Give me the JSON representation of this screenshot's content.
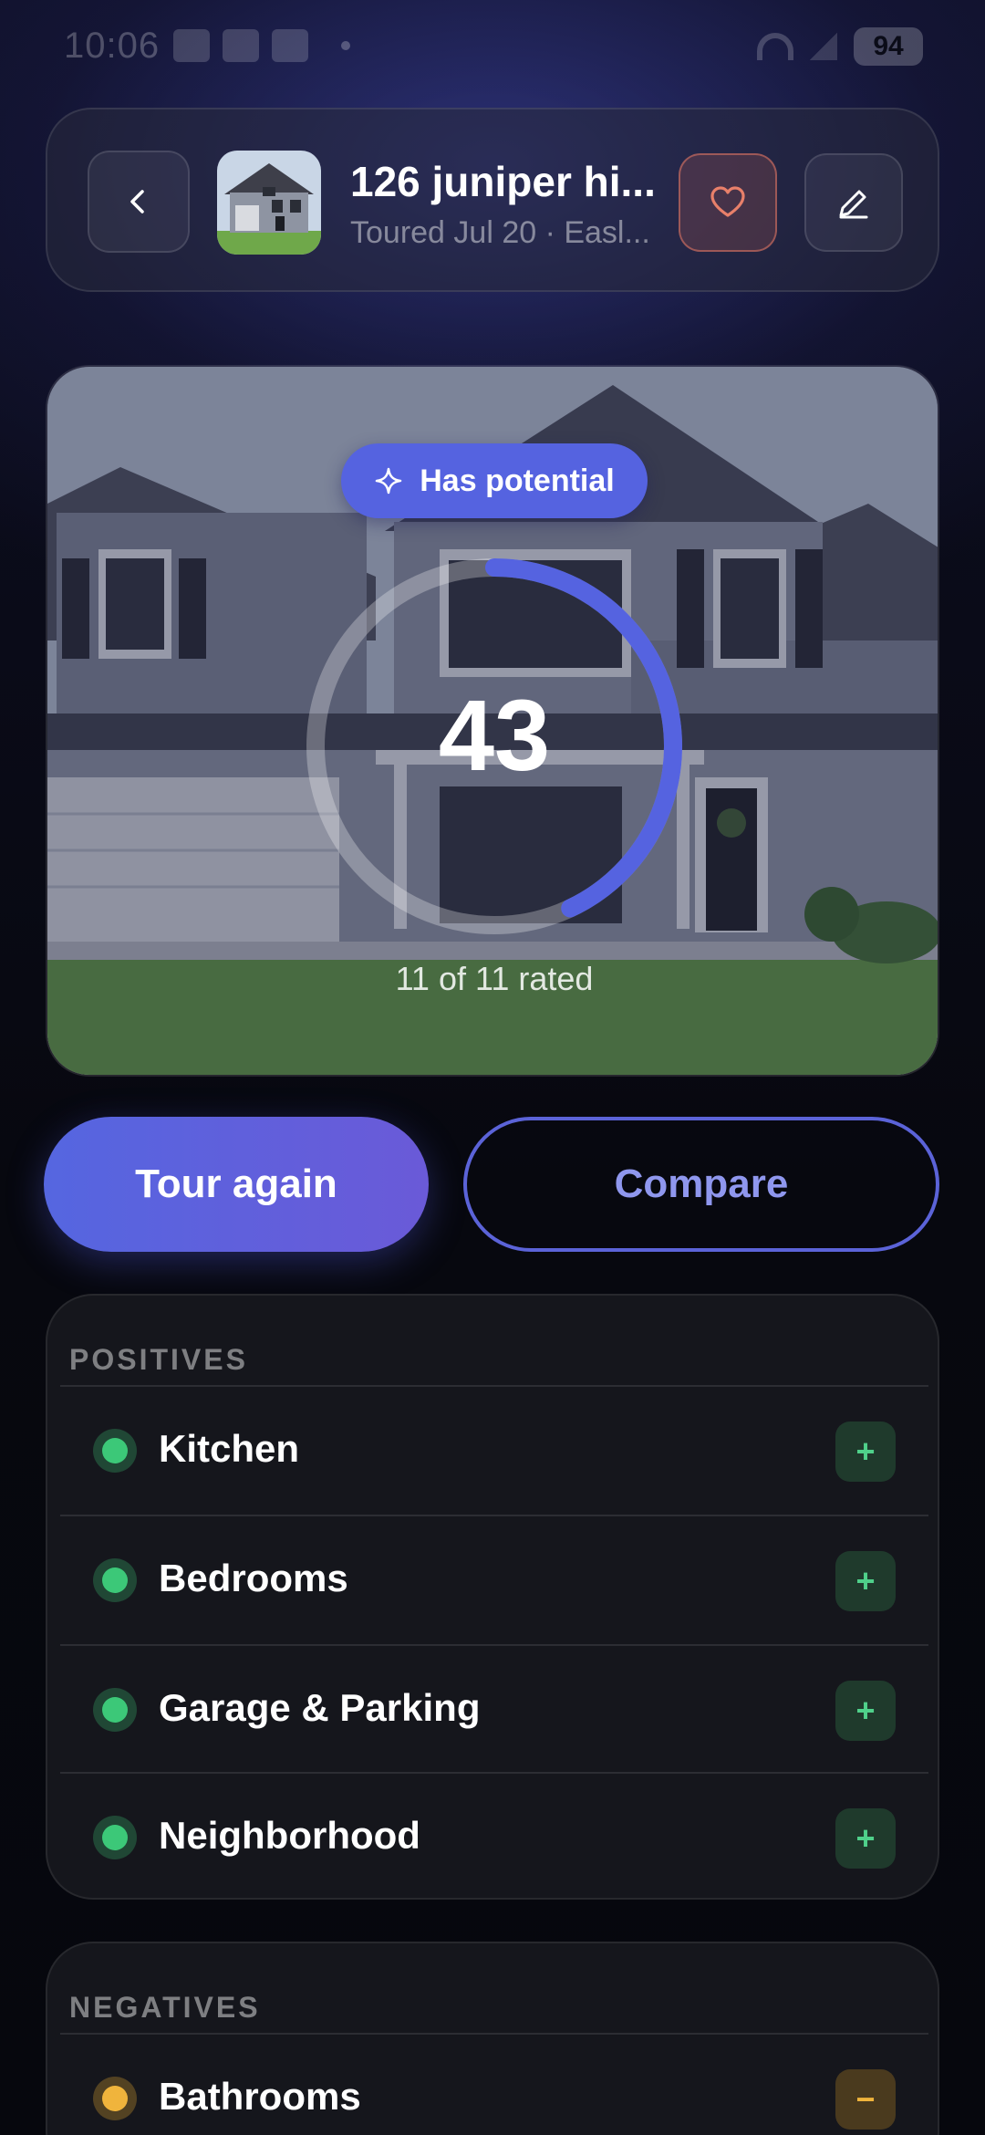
{
  "status_bar": {
    "time": "10:06",
    "battery": "94"
  },
  "header": {
    "title": "126 juniper hi...",
    "subtitle": "Toured Jul 20 · Easl...",
    "icons": {
      "back": "chevron-left-icon",
      "favorite": "heart-icon",
      "edit": "pencil-icon"
    }
  },
  "hero": {
    "badge_label": "Has potential",
    "badge_icon": "sparkle-icon",
    "score": "43",
    "score_progress": 0.43,
    "rated_text": "11 of 11 rated"
  },
  "actions": {
    "primary_label": "Tour again",
    "secondary_label": "Compare"
  },
  "positives": {
    "title": "POSITIVES",
    "items": [
      {
        "label": "Kitchen",
        "action": "+"
      },
      {
        "label": "Bedrooms",
        "action": "+"
      },
      {
        "label": "Garage & Parking",
        "action": "+"
      },
      {
        "label": "Neighborhood",
        "action": "+"
      }
    ]
  },
  "negatives": {
    "title": "NEGATIVES",
    "items": [
      {
        "label": "Bathrooms",
        "action": "−"
      }
    ]
  },
  "colors": {
    "accent": "#5563e0",
    "positive": "#3cc878",
    "negative": "#f0b43c",
    "favorite": "#e8806a"
  }
}
